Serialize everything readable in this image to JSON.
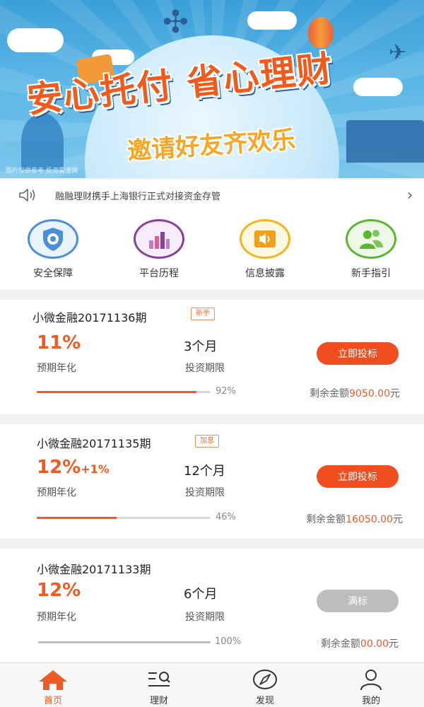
{
  "banner": {
    "headline": "安心托付 省心理财",
    "subline": "邀请好友齐欢乐",
    "watermark": "图片仅供参考 投资需谨慎"
  },
  "notice": {
    "icon": "speaker-icon",
    "text": "融融理财携手上海银行正式对接资金存管",
    "chevron": "›"
  },
  "quick_menu": [
    {
      "label": "安全保障",
      "icon": "shield-icon",
      "color": "#4a8fd6"
    },
    {
      "label": "平台历程",
      "icon": "bar-chart-icon",
      "color": "#8b3f9c"
    },
    {
      "label": "信息披露",
      "icon": "megaphone-icon",
      "color": "#f2b61c"
    },
    {
      "label": "新手指引",
      "icon": "users-icon",
      "color": "#5cb531"
    }
  ],
  "products": [
    {
      "name": "小微金融20171136期",
      "tag": "新手",
      "rate": "11%",
      "rate_extra": "",
      "rate_label": "预期年化",
      "term": "3个月",
      "term_label": "投资期限",
      "button": "立即投标",
      "button_state": "active",
      "progress": 92,
      "progress_text": "92%",
      "remain_label": "剩余金额",
      "remain_amount": "9050.00",
      "remain_unit": "元"
    },
    {
      "name": "小微金融20171135期",
      "tag": "加息",
      "rate": "12%",
      "rate_extra": "+1%",
      "rate_label": "预期年化",
      "term": "12个月",
      "term_label": "投资期限",
      "button": "立即投标",
      "button_state": "active",
      "progress": 46,
      "progress_text": "46%",
      "remain_label": "剩余金额",
      "remain_amount": "16050.00",
      "remain_unit": "元"
    },
    {
      "name": "小微金融20171133期",
      "tag": "",
      "rate": "12%",
      "rate_extra": "",
      "rate_label": "预期年化",
      "term": "6个月",
      "term_label": "投资期限",
      "button": "满标",
      "button_state": "disabled",
      "progress": 100,
      "progress_text": "100%",
      "remain_label": "剩余金额",
      "remain_amount": "00.00",
      "remain_unit": "元"
    }
  ],
  "tabbar": [
    {
      "label": "首页",
      "icon": "home-icon",
      "active": true
    },
    {
      "label": "理财",
      "icon": "finance-list-icon",
      "active": false
    },
    {
      "label": "发现",
      "icon": "compass-icon",
      "active": false
    },
    {
      "label": "我的",
      "icon": "user-icon",
      "active": false
    }
  ],
  "colors": {
    "accent": "#f05a24",
    "disabled": "#bdbdbd"
  }
}
